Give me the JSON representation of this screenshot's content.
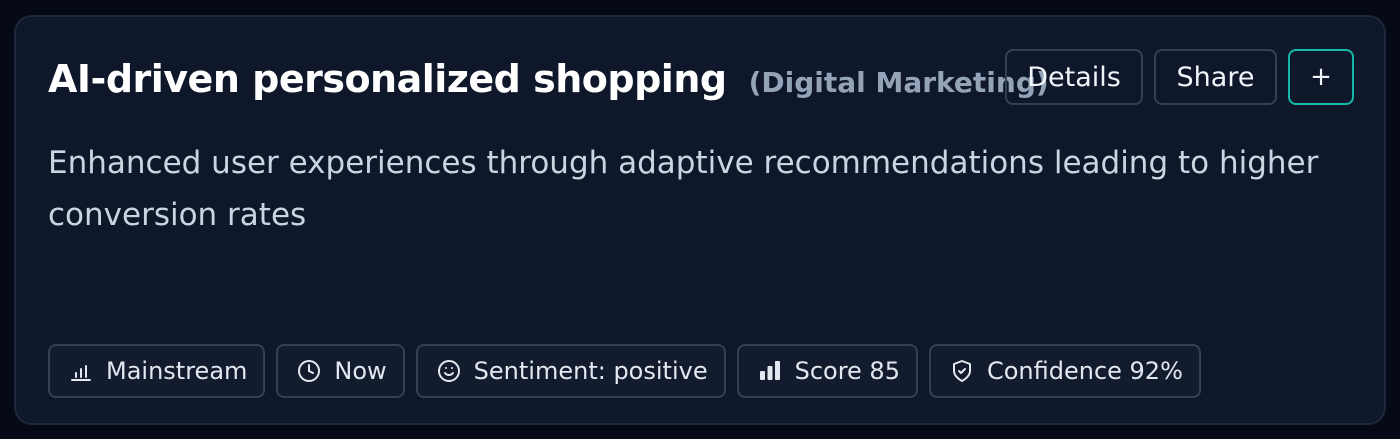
{
  "card": {
    "title": "AI-driven personalized shopping",
    "category": "(Digital Marketing)",
    "description": "Enhanced user experiences through adaptive recommendations leading to higher conversion rates",
    "actions": {
      "details_label": "Details",
      "share_label": "Share",
      "add_label": "+"
    },
    "tags": [
      {
        "icon": "bar-chart-icon",
        "label": "Mainstream"
      },
      {
        "icon": "clock-icon",
        "label": "Now"
      },
      {
        "icon": "smiley-icon",
        "label": "Sentiment: positive"
      },
      {
        "icon": "signal-bars-icon",
        "label": "Score 85"
      },
      {
        "icon": "shield-check-icon",
        "label": "Confidence 92%"
      }
    ]
  },
  "colors": {
    "background": "#060a16",
    "card": "#0f172a",
    "border": "#334155",
    "accent": "#14b8a6",
    "muted_text": "#94a3b8"
  }
}
